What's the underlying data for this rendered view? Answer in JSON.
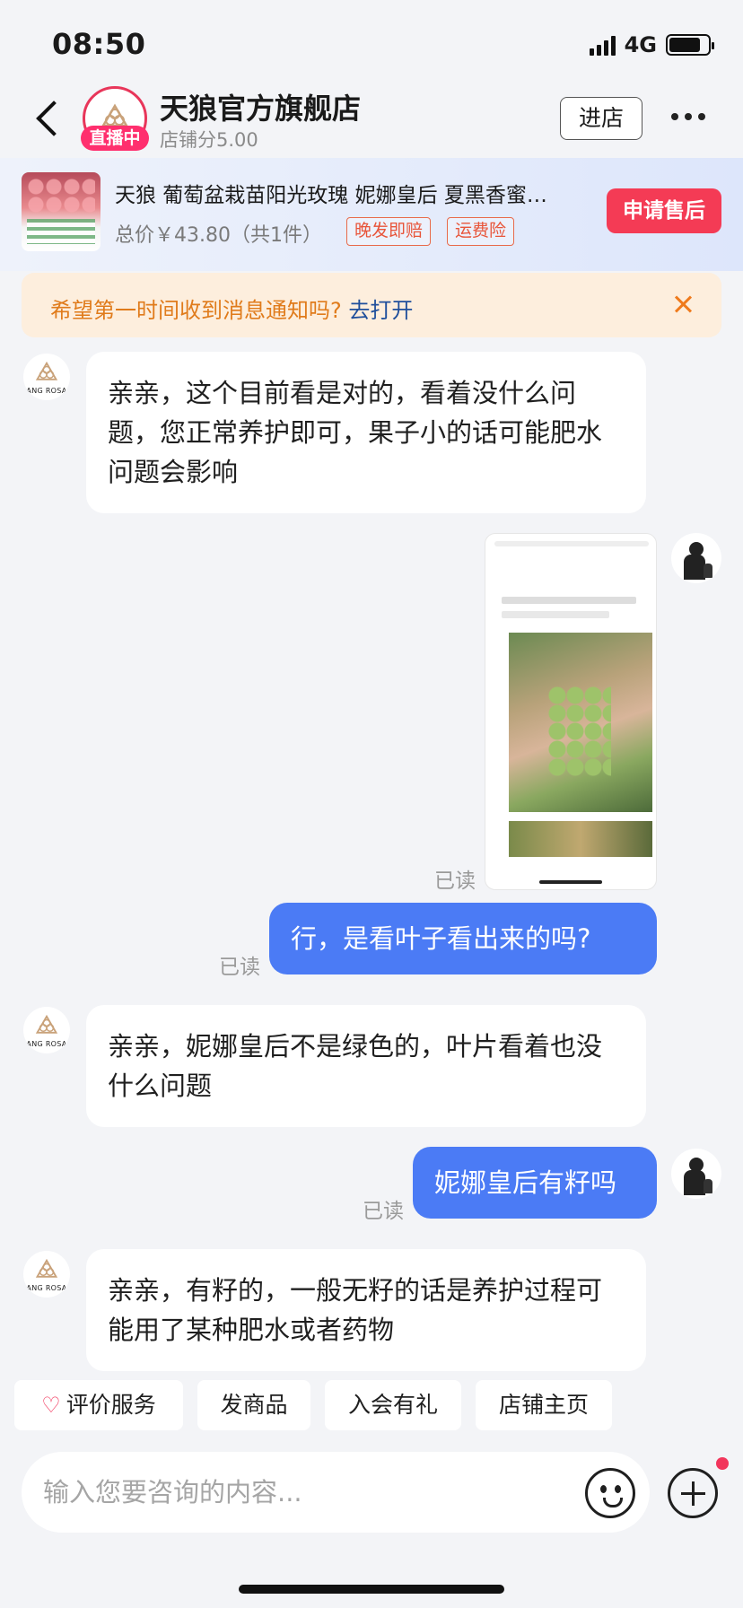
{
  "status_bar": {
    "time": "08:50",
    "network": "4G"
  },
  "header": {
    "shop_name": "天狼官方旗舰店",
    "live_badge": "直播中",
    "shop_score": "店铺分5.00",
    "enter_shop_label": "进店"
  },
  "product": {
    "title": "天狼 葡萄盆栽苗阳光玫瑰 妮娜皇后 夏黑香蜜…",
    "price": "总价￥43.80（共1件）",
    "tags": [
      "晚发即赔",
      "运费险"
    ],
    "aftersale_label": "申请售后"
  },
  "notice": {
    "text": "希望第一时间收到消息通知吗?",
    "link": "去打开"
  },
  "messages": {
    "m1": "亲亲，这个目前看是对的，看着没什么问题，您正常养护即可，果子小的话可能肥水问题会影响",
    "m2_read": "已读",
    "m3": "行，是看叶子看出来的吗?",
    "m3_read": "已读",
    "m4": "亲亲，妮娜皇后不是绿色的，叶片看着也没什么问题",
    "m5": "妮娜皇后有籽吗",
    "m5_read": "已读",
    "m6": "亲亲，有籽的，一般无籽的话是养护过程可能用了某种肥水或者药物"
  },
  "shop_avatar_text": "ANG ROSA",
  "quick_actions": [
    "评价服务",
    "发商品",
    "入会有礼",
    "店铺主页"
  ],
  "input": {
    "placeholder": "输入您要咨询的内容..."
  },
  "colors": {
    "accent": "#4b7bf5",
    "brand_red": "#f43b55",
    "notice_orange": "#e07b1b"
  }
}
